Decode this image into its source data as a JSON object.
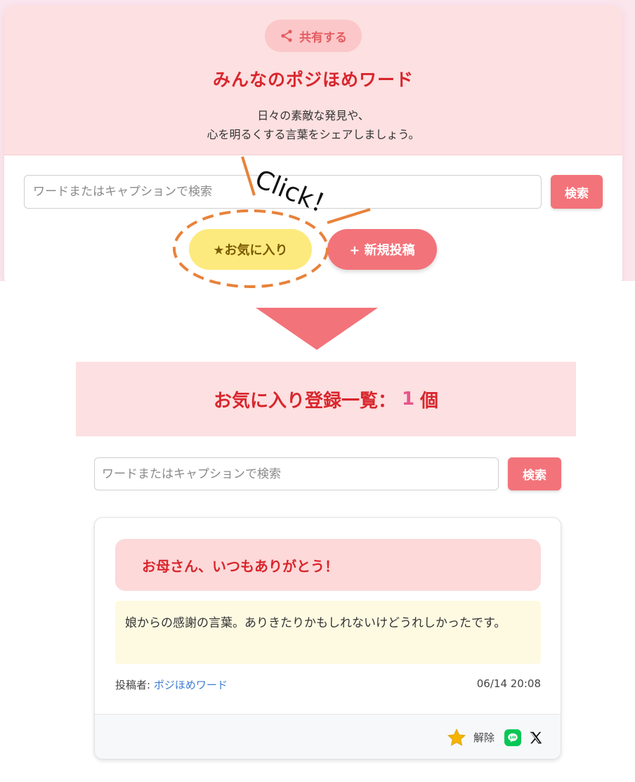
{
  "top": {
    "share_label": "共有する",
    "app_title": "みんなのポジほめワード",
    "subtitle_line1": "日々の素敵な発見や、",
    "subtitle_line2": "心を明るくする言葉をシェアしましょう。",
    "search_placeholder": "ワードまたはキャプションで検索",
    "search_button": "検索",
    "favorites_button": "★お気に入り",
    "new_post_button": "+ 新規投稿",
    "annotation": "Click！"
  },
  "favorites": {
    "title_prefix": "お気に入り登録一覧：",
    "count": "1",
    "count_suffix": "個",
    "search_placeholder": "ワードまたはキャプションで検索",
    "search_button": "検索"
  },
  "post": {
    "word": "お母さん、いつもありがとう！",
    "caption": "娘からの感謝の言葉。ありきたりかもしれないけどうれしかったです。",
    "poster_label": "投稿者: ",
    "poster_name": "ポジほめワード",
    "timestamp": "06/14 20:08",
    "unfavorite_label": "解除",
    "icons": [
      "star-icon",
      "line-icon",
      "x-icon"
    ]
  },
  "colors": {
    "accent": "#f3737a",
    "title_red": "#d9262d",
    "header_pink": "#fde0e1",
    "favorite_yellow": "#fdea7e",
    "annotation_orange": "#e8823a"
  }
}
